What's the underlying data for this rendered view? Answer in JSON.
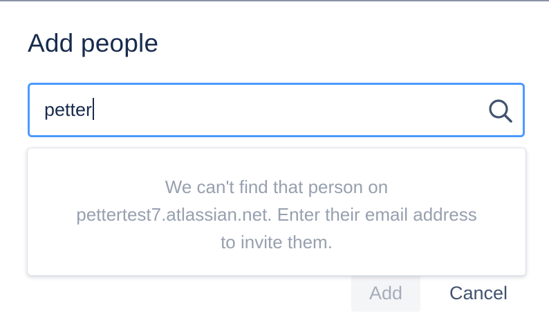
{
  "dialog": {
    "title": "Add people"
  },
  "search": {
    "value": "petter",
    "icon": "search-icon"
  },
  "dropdown": {
    "message_line1": "We can't find that person on",
    "message_line2": "pettertest7.atlassian.net. Enter their email address",
    "message_line3": "to invite them."
  },
  "footer": {
    "add_label": "Add",
    "cancel_label": "Cancel"
  },
  "colors": {
    "title": "#172b4d",
    "focus_border": "#4c9aff",
    "muted_text": "#97a0af",
    "disabled_button_bg": "#f4f5f7",
    "cancel_text": "#42526e"
  }
}
